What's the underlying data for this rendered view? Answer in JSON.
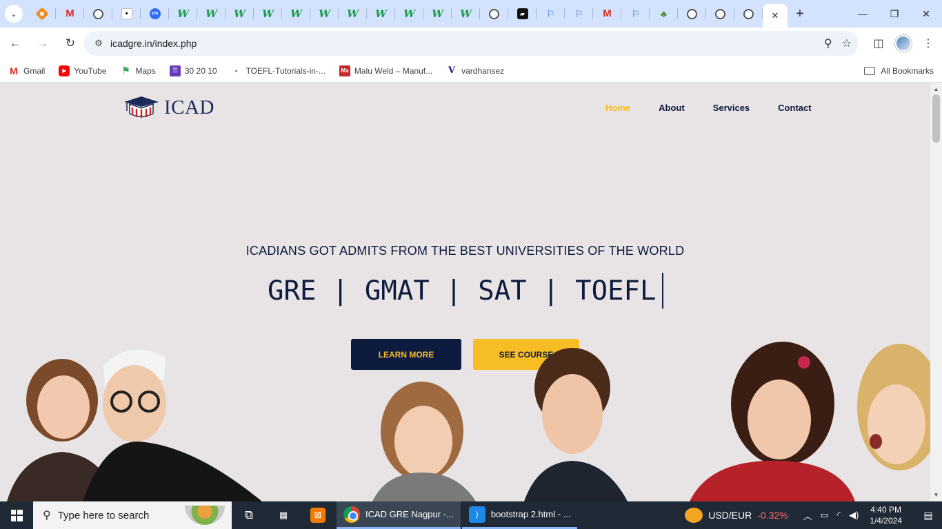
{
  "browser": {
    "tab_strip": {
      "pinned_tabs": [
        {
          "icon": "orange-cube-icon",
          "glyph": "◆",
          "style": "fav-orange"
        },
        {
          "icon": "gmail-icon",
          "glyph": "M",
          "style": "fav-gmail"
        },
        {
          "icon": "globe-icon",
          "glyph": "",
          "style": "fav-globe"
        },
        {
          "icon": "blank-page-icon",
          "glyph": "•",
          "style": "fav-white"
        },
        {
          "icon": "zoom-icon",
          "glyph": "zm",
          "style": "fav-zoom"
        },
        {
          "icon": "w-icon",
          "glyph": "W",
          "style": "fav-w"
        },
        {
          "icon": "w-icon",
          "glyph": "W",
          "style": "fav-w"
        },
        {
          "icon": "w-icon",
          "glyph": "W",
          "style": "fav-w"
        },
        {
          "icon": "w-icon",
          "glyph": "W",
          "style": "fav-w"
        },
        {
          "icon": "w-icon",
          "glyph": "W",
          "style": "fav-w"
        },
        {
          "icon": "w-icon",
          "glyph": "W",
          "style": "fav-w"
        },
        {
          "icon": "w-icon",
          "glyph": "W",
          "style": "fav-w"
        },
        {
          "icon": "w-icon",
          "glyph": "W",
          "style": "fav-w"
        },
        {
          "icon": "w-icon",
          "glyph": "W",
          "style": "fav-w"
        },
        {
          "icon": "w-icon",
          "glyph": "W",
          "style": "fav-w"
        },
        {
          "icon": "w-icon",
          "glyph": "W",
          "style": "fav-w"
        },
        {
          "icon": "globe-icon",
          "glyph": "",
          "style": "fav-globe"
        },
        {
          "icon": "dark-flag-icon",
          "glyph": "▰",
          "style": "fav-dark"
        },
        {
          "icon": "flag-icon",
          "glyph": "⚐",
          "style": "fav-flag"
        },
        {
          "icon": "flag-icon",
          "glyph": "⚐",
          "style": "fav-flag"
        },
        {
          "icon": "gmail-icon",
          "glyph": "M",
          "style": "fav-gmail"
        },
        {
          "icon": "flag-icon",
          "glyph": "⚐",
          "style": "fav-flag"
        },
        {
          "icon": "green-plant-icon",
          "glyph": "♣",
          "style": "fav-green"
        },
        {
          "icon": "globe-icon",
          "glyph": "",
          "style": "fav-globe"
        },
        {
          "icon": "globe-icon",
          "glyph": "",
          "style": "fav-globe"
        },
        {
          "icon": "globe-icon",
          "glyph": "",
          "style": "fav-globe"
        }
      ],
      "active_tab_close": "✕",
      "new_tab": "+"
    },
    "window_controls": {
      "minimize": "—",
      "maximize": "❐",
      "close": "✕"
    },
    "toolbar": {
      "back": "←",
      "forward": "→",
      "reload": "↻",
      "site_info": "⚙",
      "url": "icadgre.in/index.php",
      "zoom": "⚲",
      "bookmark_star": "☆",
      "side_panel": "◫",
      "menu": "⋮"
    },
    "bookmarks": [
      {
        "label": "Gmail",
        "icon": "gmail-icon",
        "glyph": "M",
        "style": "bm-gmail"
      },
      {
        "label": "YouTube",
        "icon": "youtube-icon",
        "glyph": "▶",
        "style": "bm-yt"
      },
      {
        "label": "Maps",
        "icon": "maps-icon",
        "glyph": "⚑",
        "style": "bm-maps"
      },
      {
        "label": "30 20 10",
        "icon": "forms-icon",
        "glyph": "☰",
        "style": "bm-form"
      },
      {
        "label": "TOEFL-Tutorials-in-...",
        "icon": "doc-icon",
        "glyph": "•",
        "style": "bm-doc"
      },
      {
        "label": "Malu Weld – Manuf...",
        "icon": "malu-icon",
        "glyph": "Ma",
        "style": "bm-malu"
      },
      {
        "label": "vardhansez",
        "icon": "v-icon",
        "glyph": "V",
        "style": "bm-v"
      }
    ],
    "all_bookmarks": "All Bookmarks"
  },
  "site": {
    "logo_text": "ICAD",
    "nav": [
      {
        "label": "Home",
        "active": true
      },
      {
        "label": "About",
        "active": false
      },
      {
        "label": "Services",
        "active": false
      },
      {
        "label": "Contact",
        "active": false
      }
    ],
    "hero": {
      "subtitle": "ICADIANS GOT ADMITS FROM THE BEST UNIVERSITIES OF THE WORLD",
      "title": "GRE | GMAT | SAT | TOEFL",
      "learn_more": "LEARN MORE",
      "see_course": "SEE COURSE"
    },
    "colors": {
      "navy": "#0d1b3e",
      "yellow": "#f6bd25",
      "background": "#e8e4e6"
    }
  },
  "taskbar": {
    "search_placeholder": "Type here to search",
    "tasks": [
      {
        "label": "ICAD GRE Nagpur -...",
        "icon": "chrome-icon"
      },
      {
        "label": "bootstrap 2.html - ...",
        "icon": "vscode-icon"
      }
    ],
    "currency": "USD/EUR",
    "currency_change": "-0.32%",
    "time": "4:40 PM",
    "date": "1/4/2024"
  }
}
